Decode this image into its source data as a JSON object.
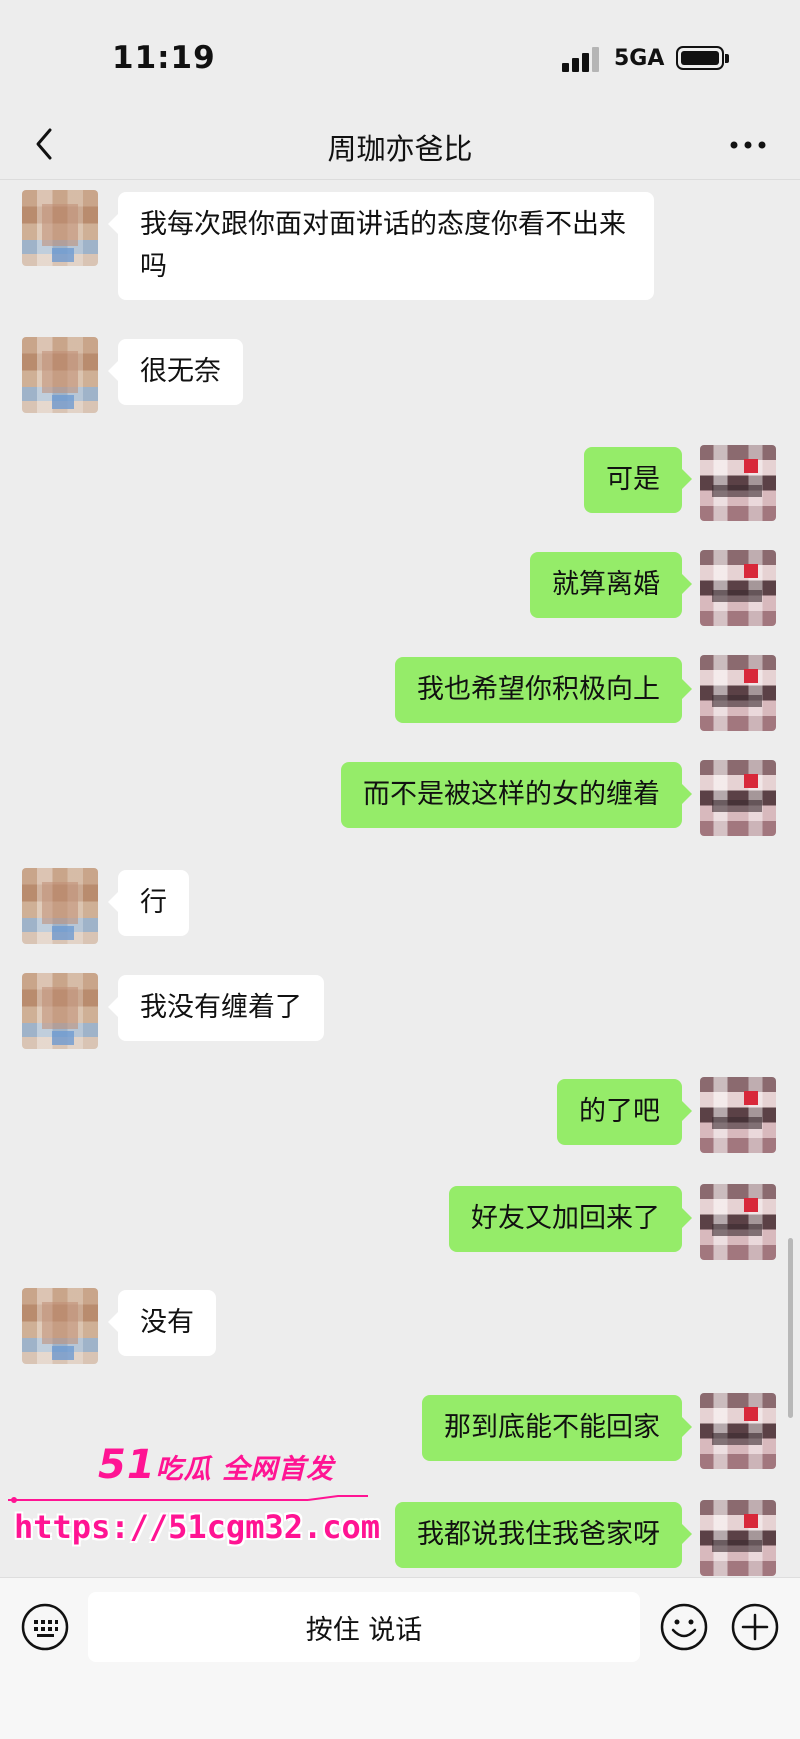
{
  "status_bar": {
    "time": "11:19",
    "network": "5GA",
    "icons": [
      "signal-icon",
      "battery-icon"
    ]
  },
  "header": {
    "title": "周珈亦爸比",
    "back_icon": "chevron-left-icon",
    "more_icon": "more-dots-icon"
  },
  "messages": [
    {
      "sender": "other",
      "text": "我每次跟你面对面讲话的态度你看不出来吗"
    },
    {
      "sender": "other",
      "text": "很无奈"
    },
    {
      "sender": "self",
      "text": "可是"
    },
    {
      "sender": "self",
      "text": "就算离婚"
    },
    {
      "sender": "self",
      "text": "我也希望你积极向上"
    },
    {
      "sender": "self",
      "text": "而不是被这样的女的缠着"
    },
    {
      "sender": "other",
      "text": "行"
    },
    {
      "sender": "other",
      "text": "我没有缠着了"
    },
    {
      "sender": "self",
      "text": "的了吧"
    },
    {
      "sender": "self",
      "text": "好友又加回来了"
    },
    {
      "sender": "other",
      "text": "没有"
    },
    {
      "sender": "self",
      "text": "那到底能不能回家"
    },
    {
      "sender": "self",
      "text": "我都说我住我爸家呀"
    }
  ],
  "watermark": {
    "brand_num": "51",
    "brand_text": "吃瓜 全网首发",
    "url": "https://51cgm32.com"
  },
  "input_bar": {
    "voice_label": "按住 说话",
    "icons": [
      "keyboard-icon",
      "emoji-icon",
      "plus-icon"
    ]
  },
  "colors": {
    "background": "#ededed",
    "bubble_self": "#95ec69",
    "bubble_other": "#ffffff",
    "watermark": "#ff1493"
  }
}
